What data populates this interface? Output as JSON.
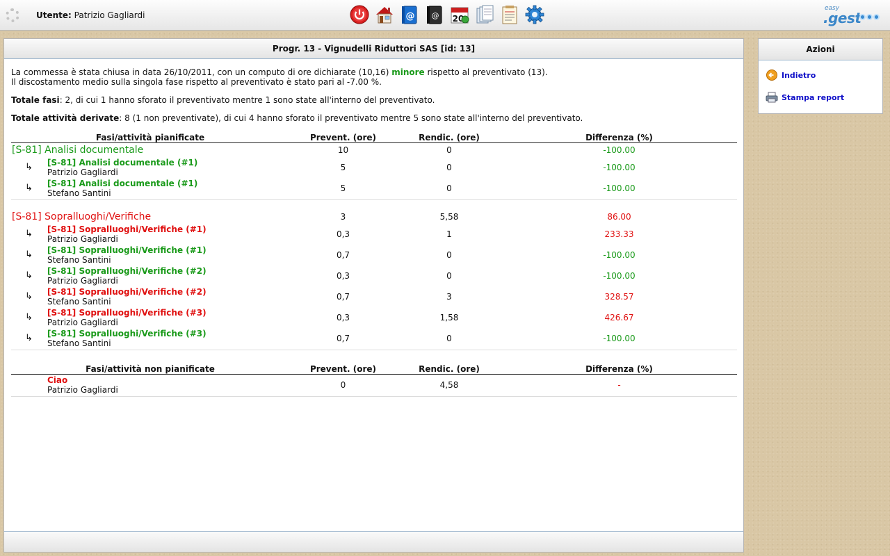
{
  "topbar": {
    "user_label": "Utente:",
    "user_name": "Patrizio Gagliardi",
    "toolbar_icons": [
      "power-icon",
      "home-icon",
      "address-book-icon",
      "contacts-book-icon",
      "calendar-icon",
      "documents-icon",
      "notes-icon",
      "settings-gear-icon"
    ],
    "brand_small": "easy",
    "brand_main": ".gest"
  },
  "main": {
    "title": "Progr. 13 - Vignudelli Riduttori SAS [id: 13]",
    "summary": {
      "line1_pre": "La commessa è stata chiusa in data 26/10/2011, con un computo di ore dichiarate (10,16) ",
      "line1_word": "minore",
      "line1_post": " rispetto al preventivato (13).",
      "line2": "Il discostamento medio sulla singola fase rispetto al preventivato è stato pari al -7.00 %.",
      "fasi_label": "Totale fasi",
      "fasi_text": ": 2, di cui 1 hanno sforato il preventivato mentre 1 sono state all'interno del preventivato.",
      "attivita_label": "Totale attività derivate",
      "attivita_text": ": 8 (1 non preventivate), di cui 4 hanno sforato il preventivato mentre 5 sono state all'interno del preventivato."
    },
    "planned_headers": {
      "name": "Fasi/attività pianificate",
      "prev": "Prevent. (ore)",
      "rend": "Rendic. (ore)",
      "diff": "Differenza (%)"
    },
    "phases": [
      {
        "title": "[S-81] Analisi documentale",
        "status": "green",
        "prev": "10",
        "rend": "0",
        "diff": "-100.00",
        "activities": [
          {
            "title": "[S-81] Analisi documentale (#1)",
            "person": "Patrizio Gagliardi",
            "prev": "5",
            "rend": "0",
            "diff": "-100.00",
            "status": "green"
          },
          {
            "title": "[S-81] Analisi documentale (#1)",
            "person": "Stefano Santini",
            "prev": "5",
            "rend": "0",
            "diff": "-100.00",
            "status": "green"
          }
        ]
      },
      {
        "title": "[S-81] Sopralluoghi/Verifiche",
        "status": "red",
        "prev": "3",
        "rend": "5,58",
        "diff": "86.00",
        "activities": [
          {
            "title": "[S-81] Sopralluoghi/Verifiche (#1)",
            "person": "Patrizio Gagliardi",
            "prev": "0,3",
            "rend": "1",
            "diff": "233.33",
            "status": "red"
          },
          {
            "title": "[S-81] Sopralluoghi/Verifiche (#1)",
            "person": "Stefano Santini",
            "prev": "0,7",
            "rend": "0",
            "diff": "-100.00",
            "status": "green"
          },
          {
            "title": "[S-81] Sopralluoghi/Verifiche (#2)",
            "person": "Patrizio Gagliardi",
            "prev": "0,3",
            "rend": "0",
            "diff": "-100.00",
            "status": "green"
          },
          {
            "title": "[S-81] Sopralluoghi/Verifiche (#2)",
            "person": "Stefano Santini",
            "prev": "0,7",
            "rend": "3",
            "diff": "328.57",
            "status": "red"
          },
          {
            "title": "[S-81] Sopralluoghi/Verifiche (#3)",
            "person": "Patrizio Gagliardi",
            "prev": "0,3",
            "rend": "1,58",
            "diff": "426.67",
            "status": "red"
          },
          {
            "title": "[S-81] Sopralluoghi/Verifiche (#3)",
            "person": "Stefano Santini",
            "prev": "0,7",
            "rend": "0",
            "diff": "-100.00",
            "status": "green"
          }
        ]
      }
    ],
    "unplanned_headers": {
      "name": "Fasi/attività non pianificate",
      "prev": "Prevent. (ore)",
      "rend": "Rendic. (ore)",
      "diff": "Differenza (%)"
    },
    "unplanned": [
      {
        "title": "Ciao",
        "person": "Patrizio Gagliardi",
        "prev": "0",
        "rend": "4,58",
        "diff": "-",
        "status": "red"
      }
    ],
    "arrow_glyph": "↳",
    "colors": {
      "green": "#1a9a1a",
      "red": "#e01010",
      "link": "#1010c8"
    }
  },
  "side": {
    "title": "Azioni",
    "links": [
      {
        "label": "Indietro",
        "icon": "back-arrow-icon"
      },
      {
        "label": "Stampa report",
        "icon": "printer-icon"
      }
    ]
  }
}
